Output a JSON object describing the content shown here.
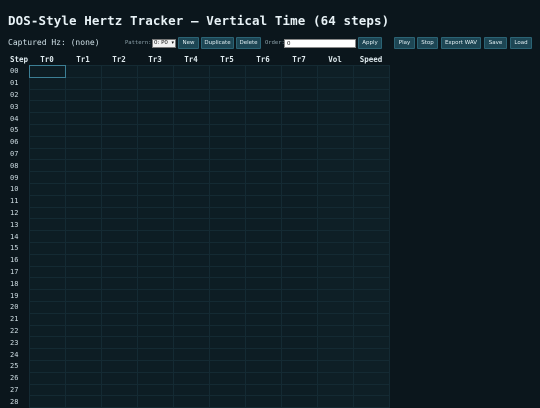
{
  "app": {
    "title": "DOS-Style Hertz Tracker — Vertical Time (64 steps)",
    "captured_label": "Captured Hz: (none)"
  },
  "toolbar": {
    "pattern_label": "Pattern:",
    "pattern_value": "0: P0",
    "new_label": "New",
    "duplicate_label": "Duplicate",
    "delete_label": "Delete",
    "order_label": "Order:",
    "order_value": "0",
    "apply_label": "Apply",
    "play_label": "Play",
    "stop_label": "Stop",
    "export_label": "Export WAV",
    "save_label": "Save",
    "load_label": "Load"
  },
  "grid": {
    "columns": [
      "Step",
      "Tr0",
      "Tr1",
      "Tr2",
      "Tr3",
      "Tr4",
      "Tr5",
      "Tr6",
      "Tr7",
      "Vol",
      "Speed"
    ],
    "steps": [
      "00",
      "01",
      "02",
      "03",
      "04",
      "05",
      "06",
      "07",
      "08",
      "09",
      "10",
      "11",
      "12",
      "13",
      "14",
      "15",
      "16",
      "17",
      "18",
      "19",
      "20",
      "21",
      "22",
      "23",
      "24",
      "25",
      "26",
      "27",
      "28"
    ]
  },
  "colors": {
    "background": "#0b161c",
    "button": "#1d4654",
    "cell": "#0d1d24",
    "cell_border": "#142a33",
    "active_cell_border": "#3c7f95"
  }
}
